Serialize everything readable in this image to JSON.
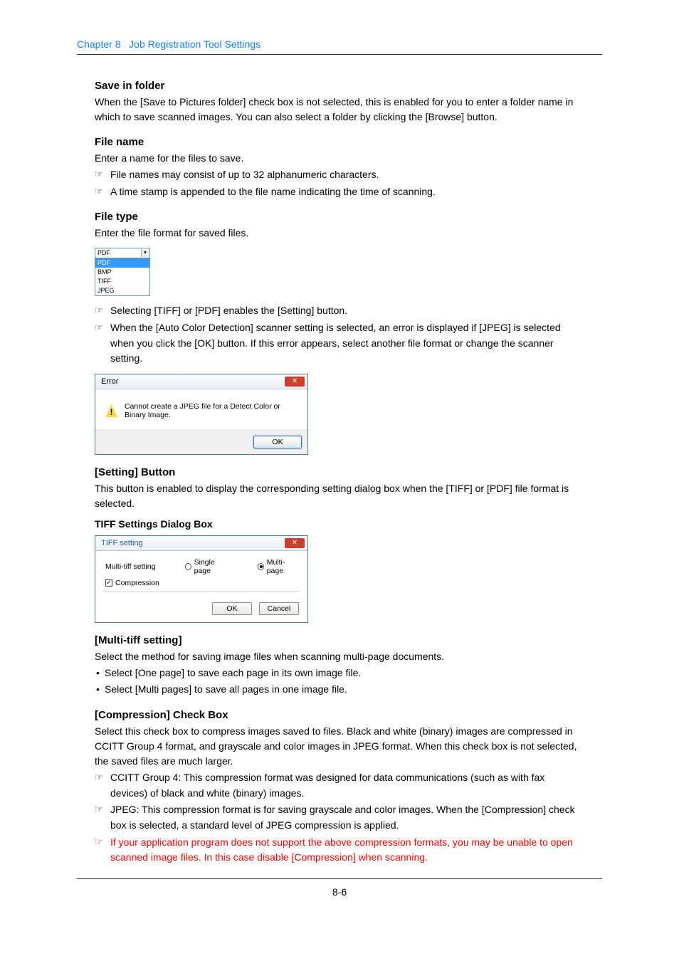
{
  "header": {
    "chapter": "Chapter 8",
    "title": "Job Registration Tool Settings"
  },
  "saveInFolder": {
    "title": "Save in folder",
    "text": "When the [Save to Pictures folder] check box is not selected, this is enabled for you to enter a folder name in which to save scanned images. You can also select a folder by clicking the [Browse] button."
  },
  "fileName": {
    "title": "File name",
    "text": "Enter a name for the files to save.",
    "notes": {
      "a": "File names may consist of up to 32 alphanumeric characters.",
      "b": "A time stamp is appended to the file name indicating the time of scanning."
    }
  },
  "fileType": {
    "title": "File type",
    "text": "Enter the file format for saved files.",
    "dropdown": {
      "selected": "PDF",
      "options": {
        "a": "PDF",
        "b": "BMP",
        "c": "TIFF",
        "d": "JPEG"
      }
    },
    "notes": {
      "a": "Selecting [TIFF] or [PDF] enables the [Setting] button.",
      "b": "When the [Auto Color Detection] scanner setting is selected, an error is displayed if [JPEG] is selected when you click the [OK] button. If this error appears, select another file format or change the scanner setting."
    }
  },
  "errorDialog": {
    "title": "Error",
    "message": "Cannot create a JPEG file for a Detect Color or Binary Image.",
    "ok": "OK"
  },
  "settingButton": {
    "title": "[Setting] Button",
    "text": "This button is enabled to display the corresponding setting dialog box when the [TIFF] or [PDF] file format is selected."
  },
  "tiffDialog": {
    "heading": "TIFF Settings Dialog Box",
    "title": "TIFF setting",
    "labels": {
      "multi": "Multi-tiff setting",
      "single": "Single page",
      "multipage": "Multi-page",
      "compression": "Compression"
    },
    "buttons": {
      "ok": "OK",
      "cancel": "Cancel"
    }
  },
  "multiTiff": {
    "title": "[Multi-tiff setting]",
    "text": "Select the method for saving image files when scanning multi-page documents.",
    "bullets": {
      "a": "Select [One page] to save each page in its own image file.",
      "b": "Select [Multi pages] to save all pages in one image file."
    }
  },
  "compression": {
    "title": "[Compression] Check Box",
    "text": "Select this check box to compress images saved to files. Black and white (binary) images are compressed in CCITT Group 4 format, and grayscale and color images in JPEG format. When this check box is not selected, the saved files are much larger.",
    "notes": {
      "a": "CCITT Group 4: This compression format was designed for data communications (such as with fax devices) of black and white (binary) images.",
      "b": "JPEG: This compression format is for saving grayscale and color images. When the [Compression] check box is selected, a standard level of JPEG compression is applied.",
      "c": "If your application program does not support the above compression formats, you may be unable to open scanned image files. In this case disable [Compression] when scanning."
    }
  },
  "pageNumber": "8-6"
}
